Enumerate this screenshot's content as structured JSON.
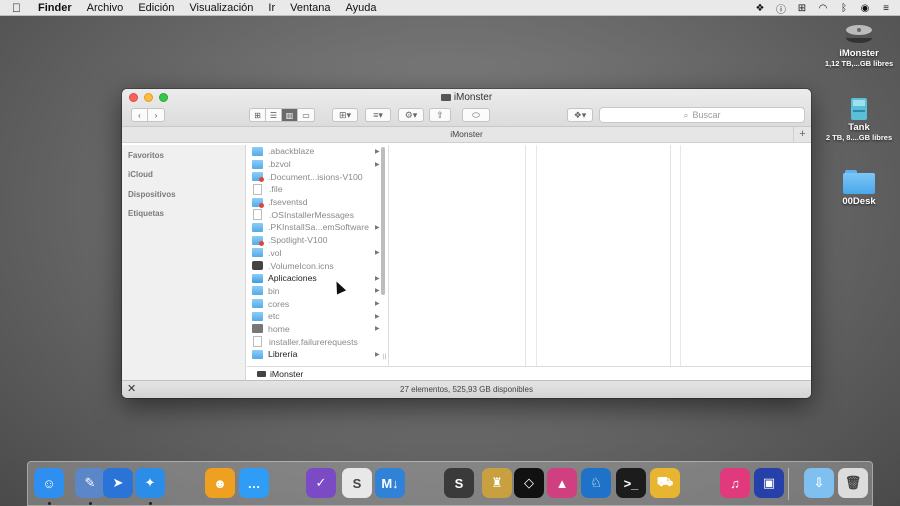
{
  "menubar": {
    "app": "Finder",
    "items": [
      "Archivo",
      "Edición",
      "Visualización",
      "Ir",
      "Ventana",
      "Ayuda"
    ],
    "status_icons": [
      "dropbox-icon",
      "info-icon",
      "vpn-icon",
      "wifi-icon",
      "bluetooth-icon",
      "globe-icon",
      "menu-list-icon"
    ]
  },
  "desktop": {
    "items": [
      {
        "name": "iMonster",
        "sub": "1,12 TB,...GB libres"
      },
      {
        "name": "Tank",
        "sub": "2 TB, 8....GB libres"
      },
      {
        "name": "00Desk",
        "sub": ""
      }
    ]
  },
  "window": {
    "title": "iMonster",
    "search_placeholder": "Buscar",
    "path_title": "iMonster",
    "sidebar": [
      "Favoritos",
      "iCloud",
      "Dispositivos",
      "Etiquetas"
    ],
    "files": [
      {
        "name": ".abackblaze",
        "icon": "folder",
        "hidden": true,
        "arrow": true
      },
      {
        "name": ".bzvol",
        "icon": "folder",
        "hidden": true,
        "arrow": true
      },
      {
        "name": ".Document...isions-V100",
        "icon": "folder-red",
        "hidden": true,
        "arrow": false
      },
      {
        "name": ".file",
        "icon": "doc",
        "hidden": true,
        "arrow": false
      },
      {
        "name": ".fseventsd",
        "icon": "folder-red",
        "hidden": true,
        "arrow": false
      },
      {
        "name": ".OSInstallerMessages",
        "icon": "doc",
        "hidden": true,
        "arrow": false
      },
      {
        "name": ".PKInstallSa...emSoftware",
        "icon": "folder",
        "hidden": true,
        "arrow": true
      },
      {
        "name": ".Spotlight-V100",
        "icon": "folder-red",
        "hidden": true,
        "arrow": false
      },
      {
        "name": ".vol",
        "icon": "folder",
        "hidden": true,
        "arrow": true
      },
      {
        "name": ".VolumeIcon.icns",
        "icon": "icns",
        "hidden": true,
        "arrow": false
      },
      {
        "name": "Aplicaciones",
        "icon": "app",
        "hidden": false,
        "arrow": true
      },
      {
        "name": "bin",
        "icon": "folder",
        "hidden": true,
        "arrow": true
      },
      {
        "name": "cores",
        "icon": "folder",
        "hidden": true,
        "arrow": true
      },
      {
        "name": "etc",
        "icon": "folder",
        "hidden": true,
        "arrow": true
      },
      {
        "name": "home",
        "icon": "home",
        "hidden": true,
        "arrow": true
      },
      {
        "name": "installer.failurerequests",
        "icon": "doc",
        "hidden": true,
        "arrow": false
      },
      {
        "name": "Librería",
        "icon": "folder",
        "hidden": false,
        "arrow": true
      }
    ],
    "bottom_path": "iMonster",
    "status": "27 elementos, 525,93 GB disponibles"
  },
  "dock": {
    "apps": [
      {
        "name": "finder",
        "glyph": "☺",
        "color": "#2f8ff0",
        "running": true
      },
      {
        "name": "preview",
        "glyph": "✎",
        "color": "#5b86c8",
        "running": true
      },
      {
        "name": "launchpad",
        "glyph": "➤",
        "color": "#2a74d8",
        "running": false
      },
      {
        "name": "safari",
        "glyph": "✦",
        "color": "#2b8de8",
        "running": true
      },
      {
        "name": "photo-booth",
        "glyph": "☻",
        "color": "#f0a020",
        "running": false
      },
      {
        "name": "messages",
        "glyph": "…",
        "color": "#2f9cf5",
        "running": false
      },
      {
        "name": "omnifocus",
        "glyph": "✓",
        "color": "#7b4bc6",
        "running": false
      },
      {
        "name": "slack",
        "glyph": "S",
        "color": "#e8e8e8",
        "running": false
      },
      {
        "name": "mweb",
        "glyph": "M↓",
        "color": "#2f82d5",
        "running": false
      },
      {
        "name": "sublime-text",
        "glyph": "S",
        "color": "#3a3a3a",
        "running": false
      },
      {
        "name": "tower",
        "glyph": "♜",
        "color": "#c8a040",
        "running": false
      },
      {
        "name": "xcode-dev",
        "glyph": "◇",
        "color": "#111111",
        "running": false
      },
      {
        "name": "prism",
        "glyph": "▲",
        "color": "#d04080",
        "running": false
      },
      {
        "name": "sequel",
        "glyph": "♘",
        "color": "#1e73c8",
        "running": false
      },
      {
        "name": "terminal",
        "glyph": ">_",
        "color": "#1c1c1c",
        "running": false
      },
      {
        "name": "transmit",
        "glyph": "⛟",
        "color": "#e8b530",
        "running": false
      },
      {
        "name": "itunes",
        "glyph": "♫",
        "color": "#e03a7c",
        "running": false
      },
      {
        "name": "screenflow",
        "glyph": "▣",
        "color": "#2540a8",
        "running": false
      },
      {
        "name": "downloads-folder",
        "glyph": "⇩",
        "color": "#7fc0f0",
        "running": false
      },
      {
        "name": "trash",
        "glyph": "🗑",
        "color": "#dcdcdc",
        "running": false
      }
    ]
  },
  "colors": {
    "accent": "#2f8ff0",
    "close": "#fc605c",
    "minimize": "#fdbc40",
    "zoom": "#34c84a"
  }
}
